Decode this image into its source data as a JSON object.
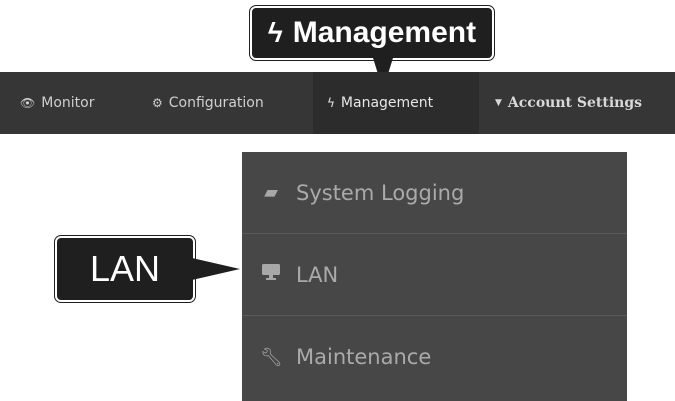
{
  "callouts": {
    "top": {
      "icon": "lightning-icon",
      "text": "Management"
    },
    "lan": {
      "text": "LAN"
    }
  },
  "navbar": {
    "items": [
      {
        "icon": "eye-icon",
        "label": "Monitor"
      },
      {
        "icon": "gears-icon",
        "label": "Configuration"
      },
      {
        "icon": "lightning-icon",
        "label": "Management",
        "active": true
      },
      {
        "icon": "caret-down-icon",
        "label": "Account Settings"
      }
    ]
  },
  "dropdown": {
    "items": [
      {
        "icon": "book-icon",
        "label": "System Logging"
      },
      {
        "icon": "monitor-icon",
        "label": "LAN"
      },
      {
        "icon": "wrench-icon",
        "label": "Maintenance"
      }
    ]
  },
  "colors": {
    "navbar_bg": "#363636",
    "navbar_active_bg": "#2c2c2c",
    "dropdown_bg": "#474747",
    "callout_bg": "#1f1f1f"
  }
}
